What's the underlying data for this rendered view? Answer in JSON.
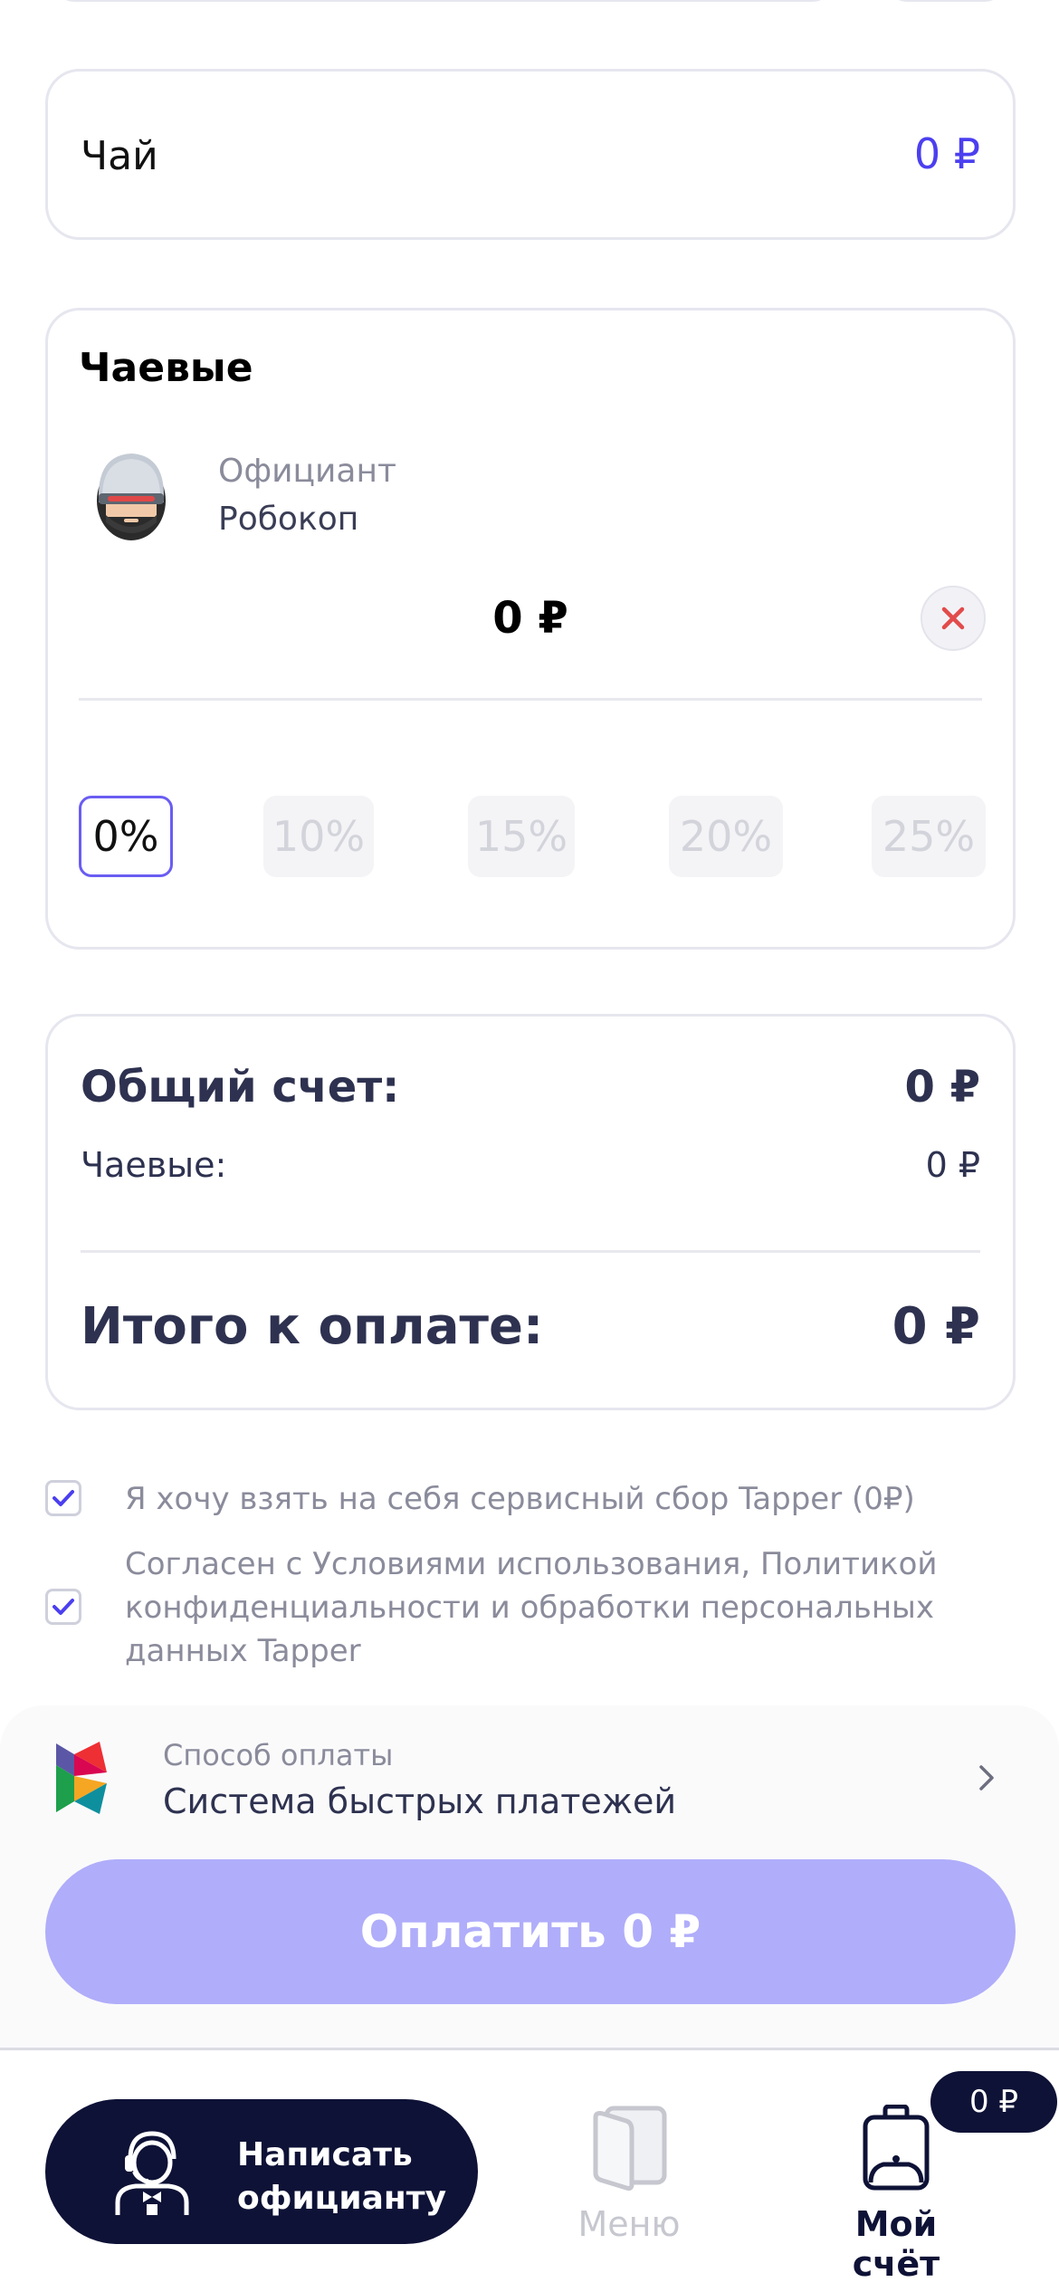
{
  "tea": {
    "title": "Чай",
    "amount": "0 ₽"
  },
  "tips": {
    "title": "Чаевые",
    "waiter_role": "Официант",
    "waiter_name": "Робокоп",
    "amount": "0 ₽",
    "percent_options": [
      "0%",
      "10%",
      "15%",
      "20%",
      "25%"
    ],
    "selected_percent": "0%"
  },
  "totals": {
    "total_label": "Общий счет:",
    "total_value": "0 ₽",
    "tips_label": "Чаевые:",
    "tips_value": "0 ₽",
    "grand_label": "Итого к оплате:",
    "grand_value": "0 ₽"
  },
  "consents": [
    {
      "text": "Я хочу взять на себя сервисный сбор Tapper (0₽)",
      "checked": true
    },
    {
      "text": "Согласен с Условиями использования, Политикой конфиденциальности и обработки персональных данных Tapper",
      "checked": true
    }
  ],
  "payment": {
    "method_label": "Способ оплаты",
    "method_value": "Система быстрых платежей",
    "pay_button": "Оплатить 0 ₽"
  },
  "nav": {
    "call_waiter": "Написать официанту",
    "menu": "Меню",
    "my_bill": "Мой счёт",
    "bill_badge": "0 ₽"
  },
  "colors": {
    "accent": "#4b3ff0",
    "pay_button": "#b0adfa",
    "dark": "#0e1236",
    "text_dark": "#2e3250",
    "muted": "#8a8b9b"
  },
  "icons": [
    "robocop-avatar-icon",
    "close-icon",
    "check-icon",
    "sbp-logo-icon",
    "chevron-right-icon",
    "waiter-icon",
    "menu-book-icon",
    "bill-bag-icon"
  ]
}
